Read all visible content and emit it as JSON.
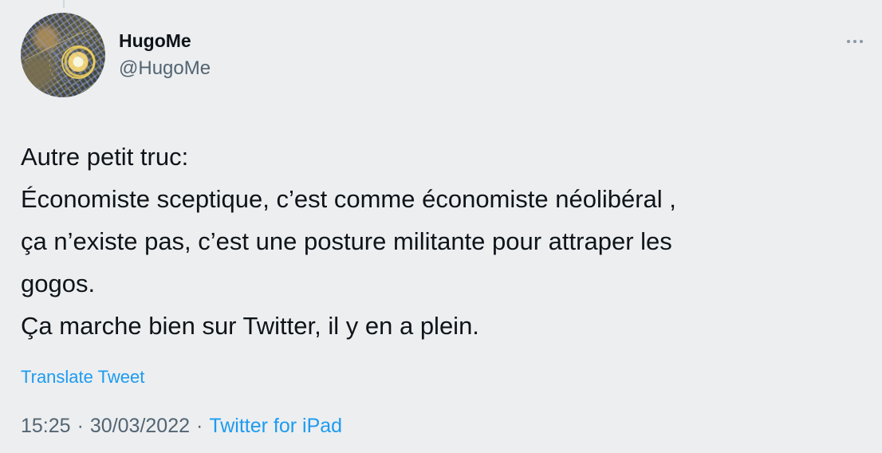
{
  "author": {
    "name": "HugoMe",
    "handle": "@HugoMe"
  },
  "more_icon": "more-horizontal-icon",
  "tweet": {
    "text": "Autre petit truc:\nÉconomiste sceptique, c’est comme économiste néolibéral ,\nça n’existe pas, c’est une posture militante pour attraper les\ngogos.\nÇa marche bien sur Twitter, il y en a plein."
  },
  "translate_label": "Translate Tweet",
  "meta": {
    "time": "15:25",
    "separator": "·",
    "date": "30/03/2022",
    "source": "Twitter for iPad"
  },
  "colors": {
    "background": "#eceef0",
    "text": "#0f1419",
    "secondary": "#536471",
    "link": "#1d9bf0"
  }
}
